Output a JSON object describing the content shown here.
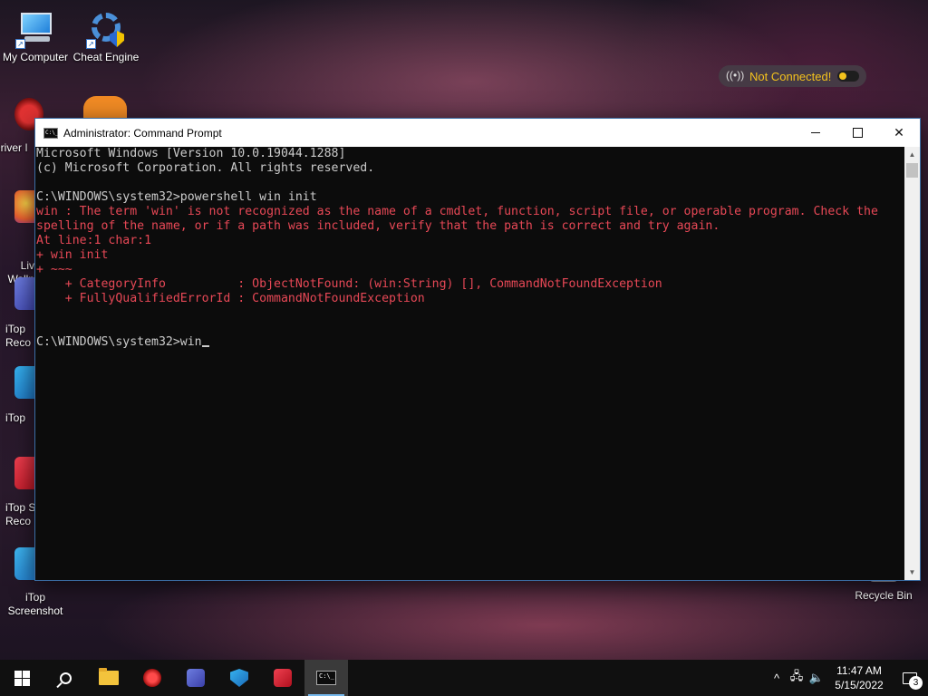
{
  "desktop": {
    "icons": [
      {
        "label": "My Computer"
      },
      {
        "label": "Cheat Engine"
      },
      {
        "label": "Driver I"
      },
      {
        "label": "Liv\nWallp"
      },
      {
        "label": "iTop\nReco"
      },
      {
        "label": "iTop"
      },
      {
        "label": "iTop S\nReco"
      },
      {
        "label": "iTop\nScreenshot"
      }
    ],
    "recycle_bin": {
      "label": "Recycle Bin"
    },
    "vpn_widget": {
      "status": "Not Connected!"
    }
  },
  "window": {
    "title": "Administrator: Command Prompt",
    "icon_text": "C:\\_",
    "console_lines": [
      {
        "text": "Microsoft Windows [Version 10.0.19044.1288]",
        "type": "normal"
      },
      {
        "text": "(c) Microsoft Corporation. All rights reserved.",
        "type": "normal"
      },
      {
        "text": "",
        "type": "normal"
      },
      {
        "text": "C:\\WINDOWS\\system32>powershell win init",
        "type": "normal"
      },
      {
        "text": "win : The term 'win' is not recognized as the name of a cmdlet, function, script file, or operable program. Check the",
        "type": "error"
      },
      {
        "text": "spelling of the name, or if a path was included, verify that the path is correct and try again.",
        "type": "error"
      },
      {
        "text": "At line:1 char:1",
        "type": "error"
      },
      {
        "text": "+ win init",
        "type": "error"
      },
      {
        "text": "+ ~~~",
        "type": "error"
      },
      {
        "text": "    + CategoryInfo          : ObjectNotFound: (win:String) [], CommandNotFoundException",
        "type": "error"
      },
      {
        "text": "    + FullyQualifiedErrorId : CommandNotFoundException",
        "type": "error"
      },
      {
        "text": "",
        "type": "normal"
      },
      {
        "text": "",
        "type": "normal"
      }
    ],
    "prompt": "C:\\WINDOWS\\system32>",
    "current_input": "win",
    "scroll_up": "▲",
    "scroll_down": "▼",
    "close_symbol": "✕"
  },
  "taskbar": {
    "apps": [
      {
        "name": "start",
        "icon": "windows-logo-icon"
      },
      {
        "name": "search",
        "icon": "search-icon"
      },
      {
        "name": "file-explorer",
        "icon": "folder-icon",
        "color": "#f3c33c"
      },
      {
        "name": "driver-booster",
        "icon": "driver-booster-icon",
        "color": "#d9262e"
      },
      {
        "name": "itop-app",
        "icon": "itop-icon",
        "color": "#4a5cc9"
      },
      {
        "name": "itop-vpn",
        "icon": "shield-icon",
        "color": "#2a9bd8"
      },
      {
        "name": "itop-recorder",
        "icon": "recorder-icon",
        "color": "#e0283a"
      },
      {
        "name": "command-prompt",
        "icon": "cmd-icon"
      }
    ],
    "tray": {
      "chevron": "^",
      "network": "🖧",
      "volume": "🔈",
      "time": "11:47 AM",
      "date": "5/15/2022",
      "notification_count": "3"
    }
  }
}
